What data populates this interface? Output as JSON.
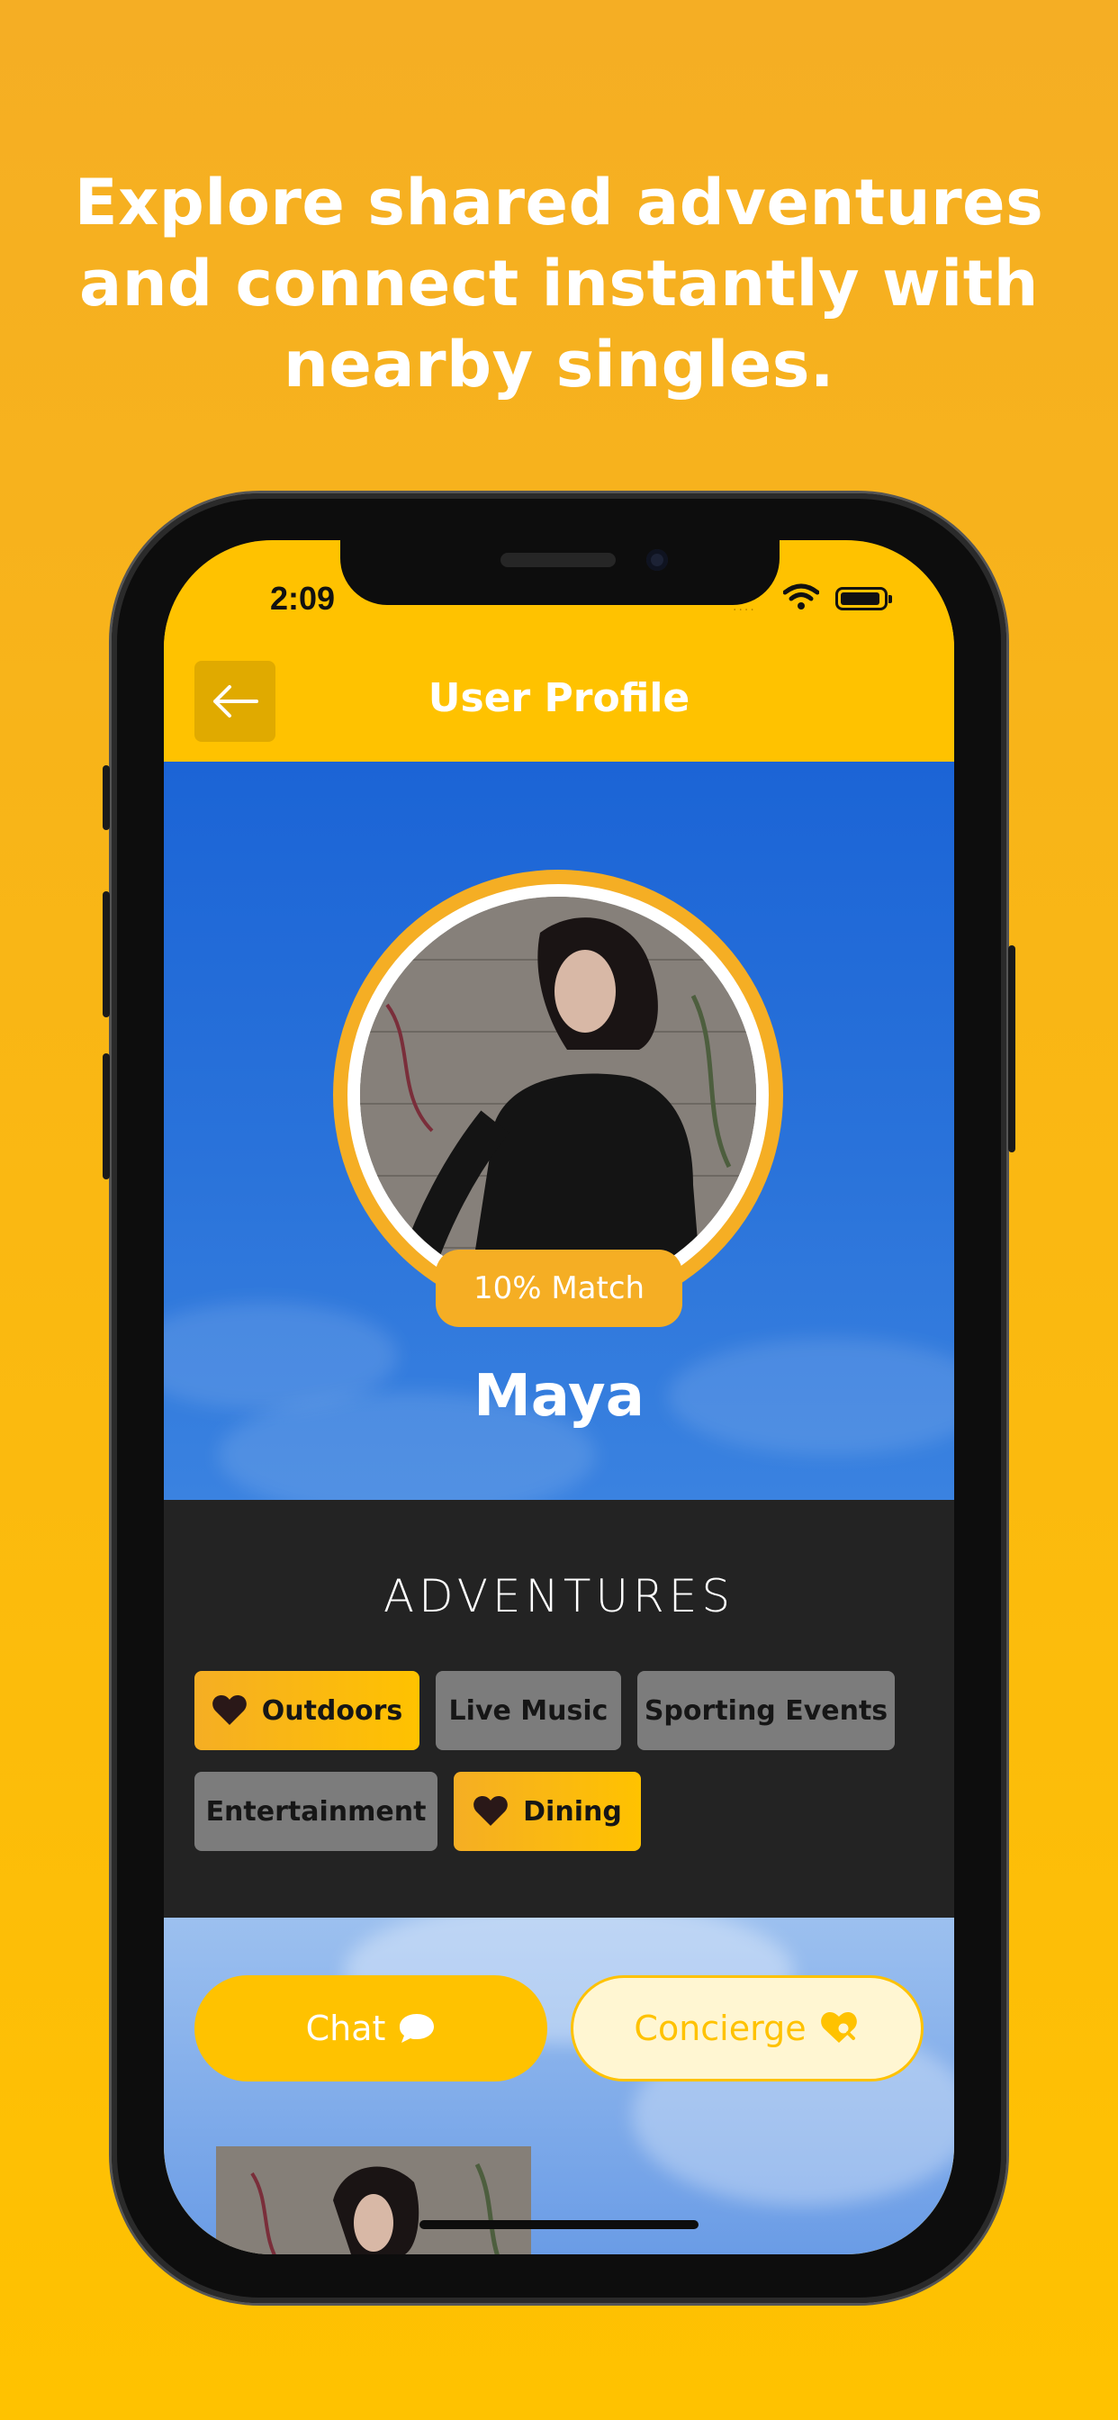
{
  "headline": "Explore shared adventures and connect instantly with nearby singles.",
  "status_bar": {
    "time": "2:09",
    "signal": "····"
  },
  "header": {
    "title": "User Profile"
  },
  "profile": {
    "match": "10% Match",
    "name": "Maya"
  },
  "adventures": {
    "title": "ADVENTURES",
    "chips": [
      {
        "label": "Outdoors",
        "selected": true
      },
      {
        "label": "Live Music",
        "selected": false
      },
      {
        "label": "Sporting Events",
        "selected": false
      },
      {
        "label": "Entertainment",
        "selected": false
      },
      {
        "label": "Dining",
        "selected": true
      }
    ]
  },
  "actions": {
    "chat_label": "Chat",
    "concierge_label": "Concierge"
  },
  "colors": {
    "accent": "#FFC200",
    "accent_dark": "#F5AE24",
    "hero_blue": "#1B64D6",
    "panel_dark": "#232323",
    "chip_inactive": "#7C7C7C"
  },
  "icons": {
    "back": "arrow-left-icon",
    "heart": "heart-icon",
    "chat": "speech-bubble-icon",
    "concierge": "heart-search-icon",
    "wifi": "wifi-icon",
    "battery": "battery-icon"
  }
}
